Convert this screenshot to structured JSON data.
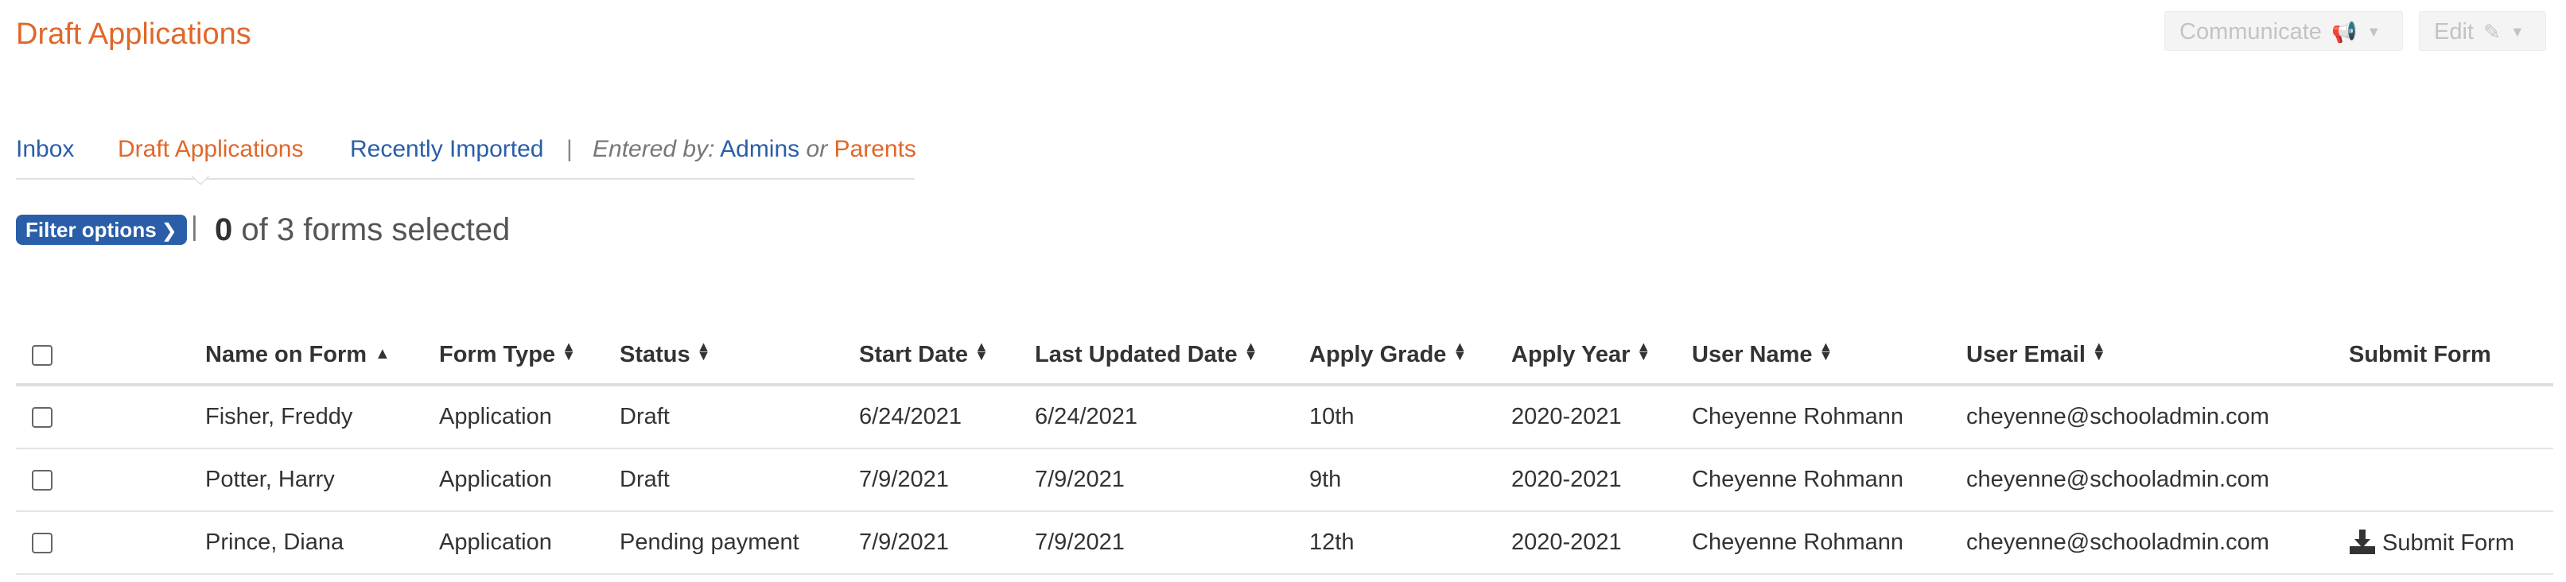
{
  "header": {
    "title": "Draft Applications",
    "communicate_label": "Communicate",
    "edit_label": "Edit",
    "communicate_icon": "megaphone-icon",
    "edit_icon": "pencil-icon"
  },
  "tabs": {
    "inbox": "Inbox",
    "draft": "Draft Applications",
    "recent": "Recently Imported",
    "separator": "|",
    "entered_by_label": "Entered by:",
    "admins": "Admins",
    "or": "or",
    "parents": "Parents"
  },
  "filter": {
    "button_label": "Filter options",
    "selected_count": "0",
    "selected_suffix": "of 3 forms selected"
  },
  "table": {
    "headers": {
      "name": "Name on Form",
      "form_type": "Form Type",
      "status": "Status",
      "start_date": "Start Date",
      "last_updated": "Last Updated Date",
      "apply_grade": "Apply Grade",
      "apply_year": "Apply Year",
      "user_name": "User Name",
      "user_email": "User Email",
      "submit": "Submit Form"
    },
    "rows": [
      {
        "name": "Fisher, Freddy",
        "form_type": "Application",
        "status": "Draft",
        "start_date": "6/24/2021",
        "last_updated": "6/24/2021",
        "apply_grade": "10th",
        "apply_year": "2020-2021",
        "user_name": "Cheyenne Rohmann",
        "user_email": "cheyenne@schooladmin.com",
        "submit": ""
      },
      {
        "name": "Potter, Harry",
        "form_type": "Application",
        "status": "Draft",
        "start_date": "7/9/2021",
        "last_updated": "7/9/2021",
        "apply_grade": "9th",
        "apply_year": "2020-2021",
        "user_name": "Cheyenne Rohmann",
        "user_email": "cheyenne@schooladmin.com",
        "submit": ""
      },
      {
        "name": "Prince, Diana",
        "form_type": "Application",
        "status": "Pending payment",
        "start_date": "7/9/2021",
        "last_updated": "7/9/2021",
        "apply_grade": "12th",
        "apply_year": "2020-2021",
        "user_name": "Cheyenne Rohmann",
        "user_email": "cheyenne@schooladmin.com",
        "submit": "Submit Form"
      }
    ]
  },
  "colors": {
    "accent_orange": "#e0672a",
    "link_blue": "#2a5ea8"
  }
}
